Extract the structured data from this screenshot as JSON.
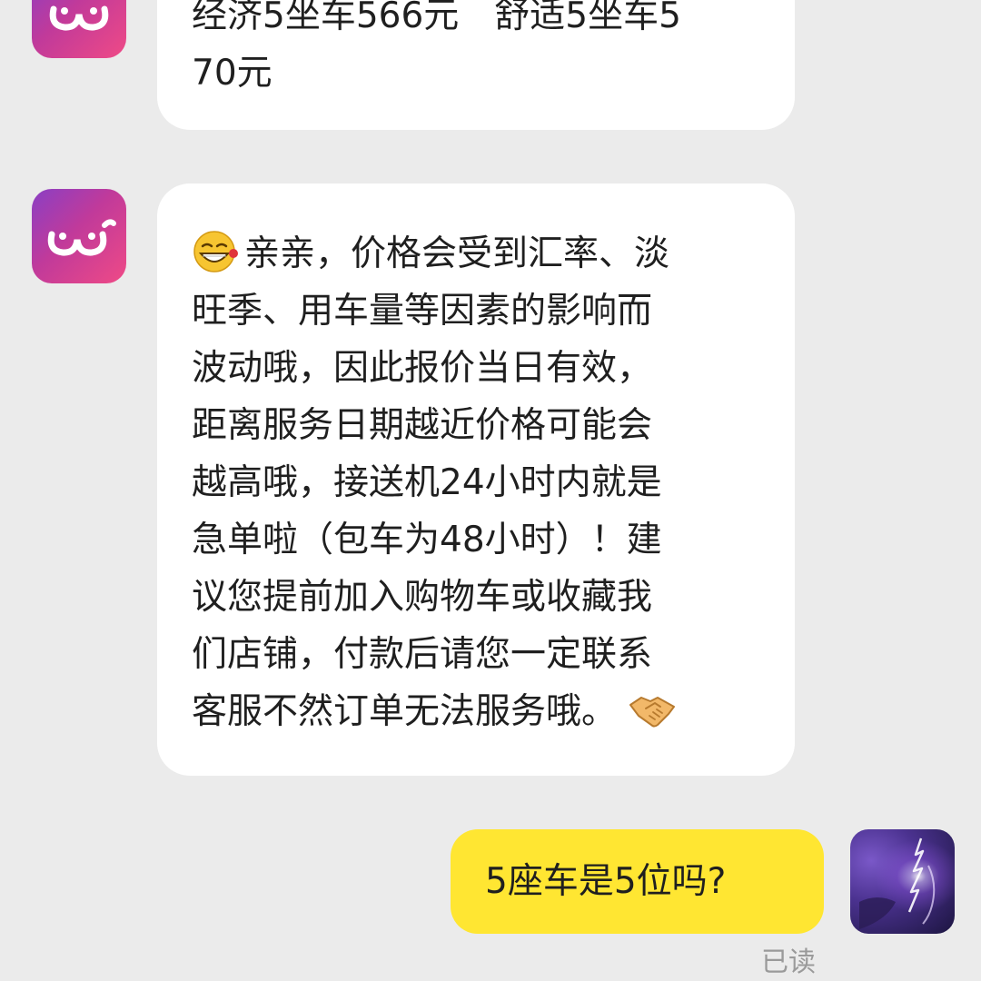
{
  "messages": [
    {
      "sender": "shop",
      "lines": [
        "经济5坐车566元　舒适5坐车5",
        "70元"
      ]
    },
    {
      "sender": "shop",
      "emoji_start": "grinning-face-emoji",
      "lines": [
        "亲亲，价格会受到汇率、淡",
        "旺季、用车量等因素的影响而",
        "波动哦，因此报价当日有效，",
        "距离服务日期越近价格可能会",
        "越高哦，接送机24小时内就是",
        "急单啦（包车为48小时）！建",
        "议您提前加入购物车或收藏我",
        "们店铺，付款后请您一定联系",
        "客服不然订单无法服务哦。"
      ],
      "emoji_end": "handshake-emoji"
    },
    {
      "sender": "me",
      "text": "5座车是5位吗?",
      "status": "已读"
    }
  ],
  "colors": {
    "background": "#ebebeb",
    "incoming_bubble": "#ffffff",
    "outgoing_bubble": "#ffe632",
    "status_text": "#9a9a9a"
  }
}
